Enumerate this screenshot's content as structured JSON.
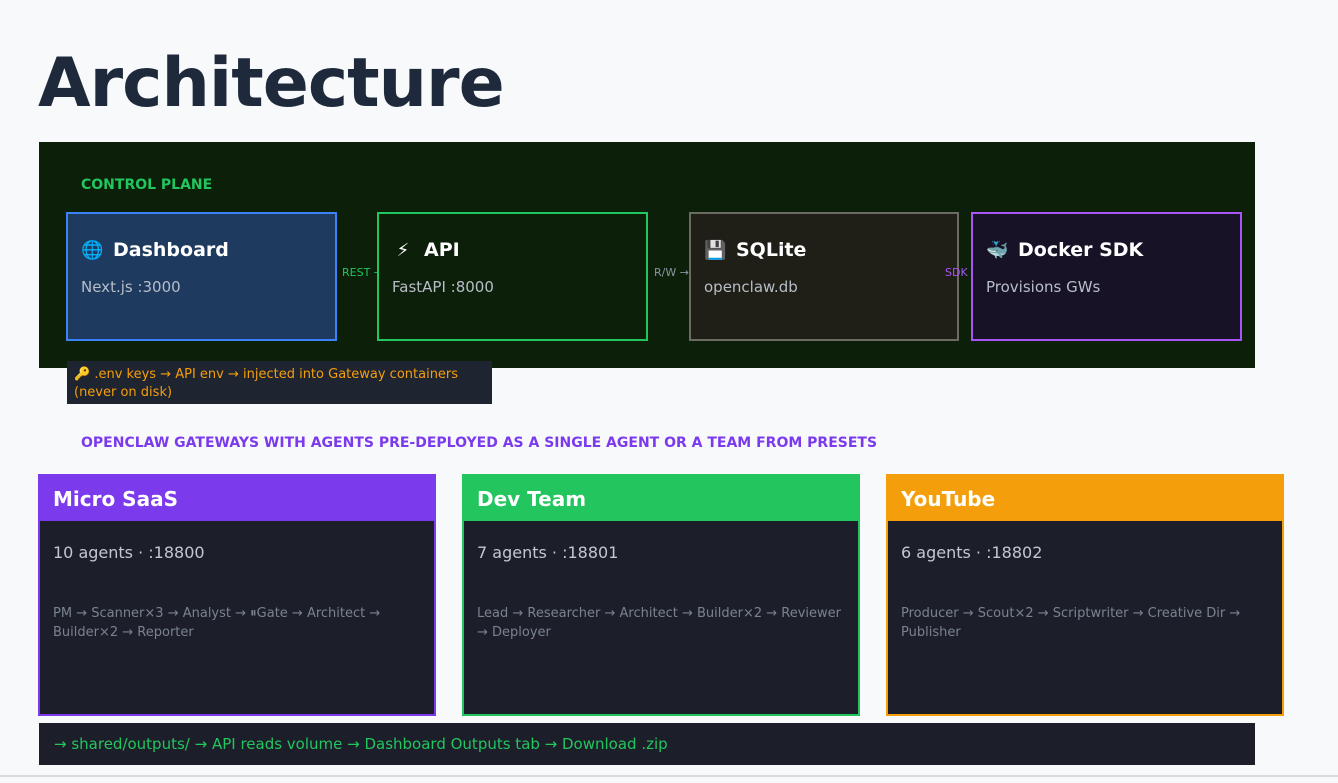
{
  "page": {
    "title": "Architecture"
  },
  "control_plane": {
    "label": "CONTROL PLANE",
    "nodes": [
      {
        "icon": "globe-icon",
        "glyph": "🌐",
        "title": "Dashboard",
        "subtitle": "Next.js :3000",
        "color": "#3b82f6"
      },
      {
        "icon": "lightning-icon",
        "glyph": "⚡",
        "title": "API",
        "subtitle": "FastAPI :8000",
        "color": "#22c55e"
      },
      {
        "icon": "floppy-disk-icon",
        "glyph": "💾",
        "title": "SQLite",
        "subtitle": "openclaw.db",
        "color": "#6b6a63"
      },
      {
        "icon": "whale-icon",
        "glyph": "🐳",
        "title": "Docker SDK",
        "subtitle": "Provisions GWs",
        "color": "#a855f7"
      }
    ],
    "edges": [
      "REST →",
      "R/W →",
      "SDK →"
    ]
  },
  "env_note": {
    "icon": "key-icon",
    "glyph": "🔑",
    "text": ".env keys → API env → injected into Gateway containers (never on disk)"
  },
  "gateways": {
    "label": "OPENCLAW GATEWAYS WITH AGENTS PRE-DEPLOYED AS A SINGLE AGENT OR A TEAM FROM PRESETS",
    "cards": [
      {
        "title": "Micro SaaS",
        "count": "10 agents · :18800",
        "flow": "PM → Scanner×3 → Analyst → ⏸Gate → Architect → Builder×2 → Reporter",
        "color": "#7c3aed"
      },
      {
        "title": "Dev Team",
        "count": "7 agents · :18801",
        "flow": "Lead → Researcher → Architect → Builder×2 → Reviewer → Deployer",
        "color": "#22c55e"
      },
      {
        "title": "YouTube",
        "count": "6 agents · :18802",
        "flow": "Producer → Scout×2 → Scriptwriter → Creative Dir → Publisher",
        "color": "#f59e0b"
      }
    ]
  },
  "footer": {
    "text": "→ shared/outputs/ → API reads volume → Dashboard Outputs tab → Download .zip"
  }
}
